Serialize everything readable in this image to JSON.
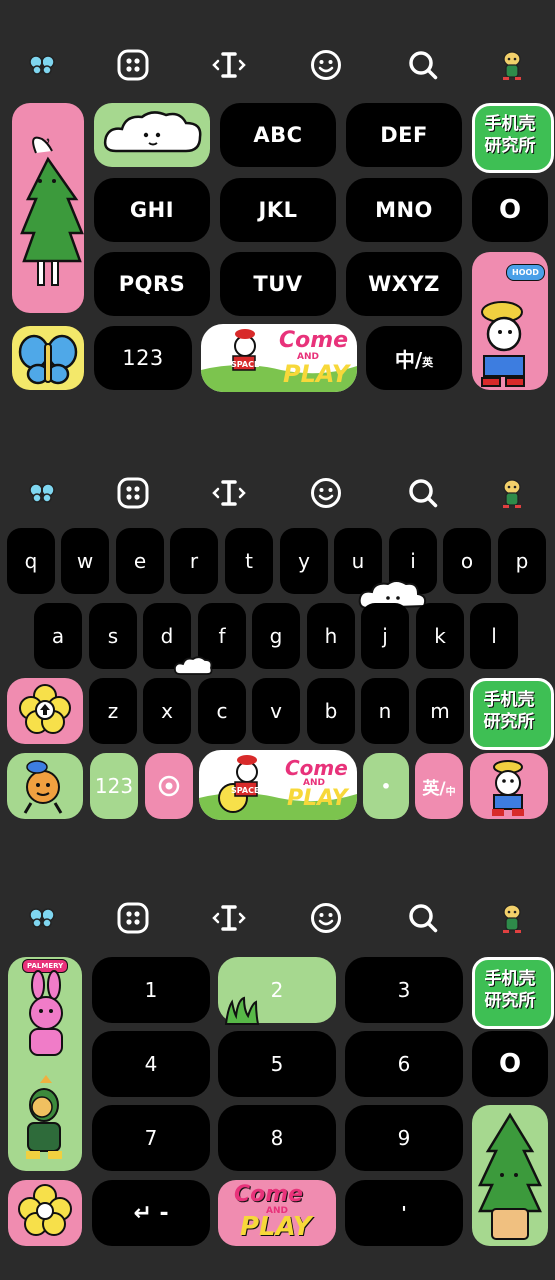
{
  "toolbar": {
    "icons": [
      "butterfly-icon",
      "grid-menu-icon",
      "text-cursor-icon",
      "emoji-face-icon",
      "search-icon",
      "mascot-dog-icon"
    ]
  },
  "keyboard1": {
    "punct": "，",
    "row1": [
      "ABC",
      "DEF"
    ],
    "row2": [
      "GHI",
      "JKL",
      "MNO"
    ],
    "row3": [
      "PQRS",
      "TUV",
      "WXYZ"
    ],
    "num_label": "123",
    "space_text": {
      "line1": "Come",
      "line2": "AND",
      "line3": "PLAY",
      "tag": "SPACE"
    },
    "lang_main": "中/",
    "lang_sub": "英",
    "logo": {
      "line1": "手机壳",
      "line2": "研究所"
    },
    "zero_symbol": "O",
    "badge": "HOOD"
  },
  "keyboard2": {
    "row1": [
      "q",
      "w",
      "e",
      "r",
      "t",
      "y",
      "u",
      "i",
      "o",
      "p"
    ],
    "row2": [
      "a",
      "s",
      "d",
      "f",
      "g",
      "h",
      "j",
      "k",
      "l"
    ],
    "row3": [
      "z",
      "x",
      "c",
      "v",
      "b",
      "n",
      "m"
    ],
    "num_label": "123",
    "dot": "•",
    "lang_main": "英/",
    "lang_sub": "中",
    "space_text": {
      "line1": "Come",
      "line2": "AND",
      "line3": "PLAY",
      "tag": "SPACE"
    },
    "logo": {
      "line1": "手机壳",
      "line2": "研究所"
    }
  },
  "keyboard3": {
    "row1": [
      "1",
      "2",
      "3"
    ],
    "row2": [
      "4",
      "5",
      "6"
    ],
    "row3": [
      "7",
      "8",
      "9"
    ],
    "zero_symbol": "O",
    "comma": "'",
    "enter_label": "↵ -",
    "space_text": {
      "line1": "Come",
      "line2": "AND",
      "line3": "PLAY"
    },
    "logo": {
      "line1": "手机壳",
      "line2": "研究所"
    },
    "badge": "PALMERY"
  },
  "colors": {
    "background": "#2b2b2b",
    "key": "#000000",
    "pink": "#f08cb0",
    "green": "#a6d88f",
    "logo_green": "#3ebf54"
  }
}
